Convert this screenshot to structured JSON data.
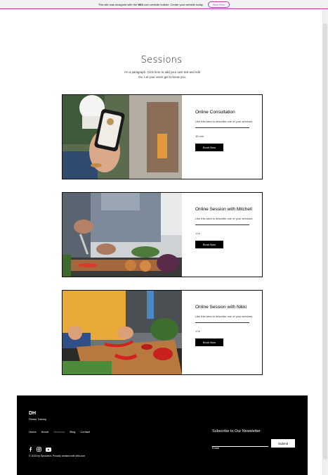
{
  "banner": {
    "text_before": "This site was designed with the",
    "logo": "WIX",
    "text_after": ".com website builder. Create your website today.",
    "cta": "Start Now"
  },
  "page": {
    "title": "Sessions",
    "description": "I'm a paragraph. Click here to add your own text and edit me. Let your users get to know you."
  },
  "sessions": [
    {
      "title": "Online Consultation",
      "description": "Use this area to describe one of your services.",
      "duration": "15 min",
      "button": "Book Now",
      "photo": "phone-in-hand-photo"
    },
    {
      "title": "Online Session with Mitchell",
      "description": "Use this area to describe one of your services.",
      "duration": "1 hr",
      "button": "Book Now",
      "photo": "chopping-vegetables-photo"
    },
    {
      "title": "Online Session with Nikki",
      "description": "Use this area to describe one of your services.",
      "duration": "1 hr",
      "button": "Book Now",
      "photo": "slicing-peppers-photo"
    }
  ],
  "footer": {
    "brand": "DH",
    "tagline": "Fitness Training",
    "nav": [
      "Home",
      "About",
      "Sessions",
      "Blog",
      "Contact"
    ],
    "active_nav": "Sessions",
    "social_icons": [
      "facebook-icon",
      "instagram-icon",
      "youtube-icon"
    ],
    "copyright": "© 2023 by Sproutect. Proudly created with Wix.com",
    "newsletter_title": "Subscribe to Our Newsletter",
    "email_placeholder": "Email",
    "submit": "Submit"
  },
  "colors": {
    "accent": "#b43bb0",
    "footer_bg": "#000000",
    "button_bg": "#000000"
  }
}
